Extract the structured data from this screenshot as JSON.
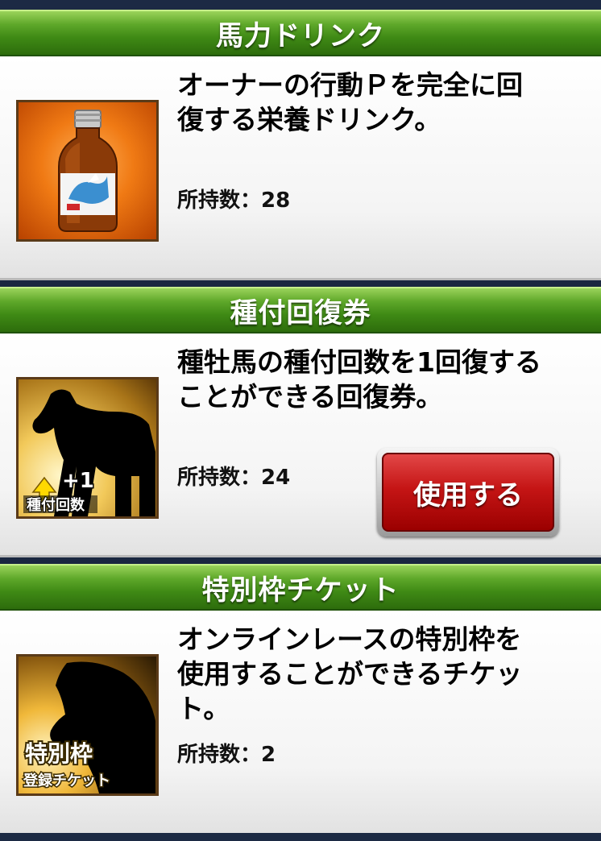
{
  "items": [
    {
      "header": "馬力ドリンク",
      "description": "オーナーの行動Ｐを完全に回\n復する栄養ドリンク。",
      "count_label": "所持数：",
      "count": "28",
      "icon": "energy-drink-bottle-icon"
    },
    {
      "header": "種付回復券",
      "description": "種牡馬の種付回数を1回復する\nことができる回復券。",
      "count_label": "所持数：",
      "count": "24",
      "icon": "horse-silhouette-icon",
      "icon_text": [
        "+1",
        "種付回数"
      ],
      "button_label": "使用する"
    },
    {
      "header": "特別枠チケット",
      "description": "オンラインレースの特別枠を\n使用することができるチケッ\nト。",
      "count_label": "所持数：",
      "count": "2",
      "icon": "horse-head-ticket-icon",
      "icon_text": [
        "特別枠",
        "登録チケット"
      ]
    }
  ],
  "colors": {
    "header_green": "#3f8a15",
    "button_red": "#c51515",
    "icon_orange": "#e8620a"
  }
}
